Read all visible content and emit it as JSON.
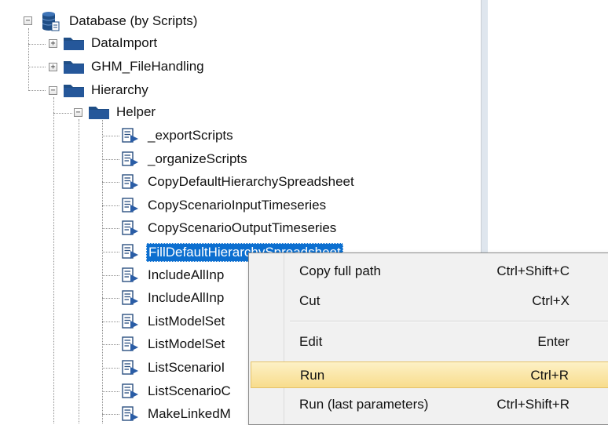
{
  "tree": {
    "root": {
      "label": "Database (by Scripts)",
      "expander": "−",
      "icon": "database-icon"
    },
    "items": [
      {
        "label": "DataImport",
        "expander": "+",
        "icon": "folder-icon"
      },
      {
        "label": "GHM_FileHandling",
        "expander": "+",
        "icon": "folder-icon"
      },
      {
        "label": "Hierarchy",
        "expander": "−",
        "icon": "folder-icon"
      },
      {
        "label": "Helper",
        "expander": "−",
        "icon": "folder-icon"
      }
    ],
    "scripts": [
      {
        "label": "_exportScripts"
      },
      {
        "label": "_organizeScripts"
      },
      {
        "label": "CopyDefaultHierarchySpreadsheet"
      },
      {
        "label": "CopyScenarioInputTimeseries"
      },
      {
        "label": "CopyScenarioOutputTimeseries"
      },
      {
        "label": "FillDefaultHierarchySpreadsheet",
        "selected": true
      },
      {
        "label": "IncludeAllInp"
      },
      {
        "label": "IncludeAllInp"
      },
      {
        "label": "ListModelSet"
      },
      {
        "label": "ListModelSet"
      },
      {
        "label": "ListScenarioI"
      },
      {
        "label": "ListScenarioC"
      },
      {
        "label": "MakeLinkedM"
      }
    ]
  },
  "context_menu": {
    "items": [
      {
        "label": "Copy full path",
        "shortcut": "Ctrl+Shift+C"
      },
      {
        "label": "Cut",
        "shortcut": "Ctrl+X"
      },
      {
        "label": "Edit",
        "shortcut": "Enter"
      },
      {
        "label": "Run",
        "shortcut": "Ctrl+R",
        "highlighted": true
      },
      {
        "label": "Run (last parameters)",
        "shortcut": "Ctrl+Shift+R"
      }
    ]
  },
  "colors": {
    "selection": "#0c6fd0",
    "folder": "#1f4e86",
    "menu_highlight": "#f8dc8c"
  }
}
